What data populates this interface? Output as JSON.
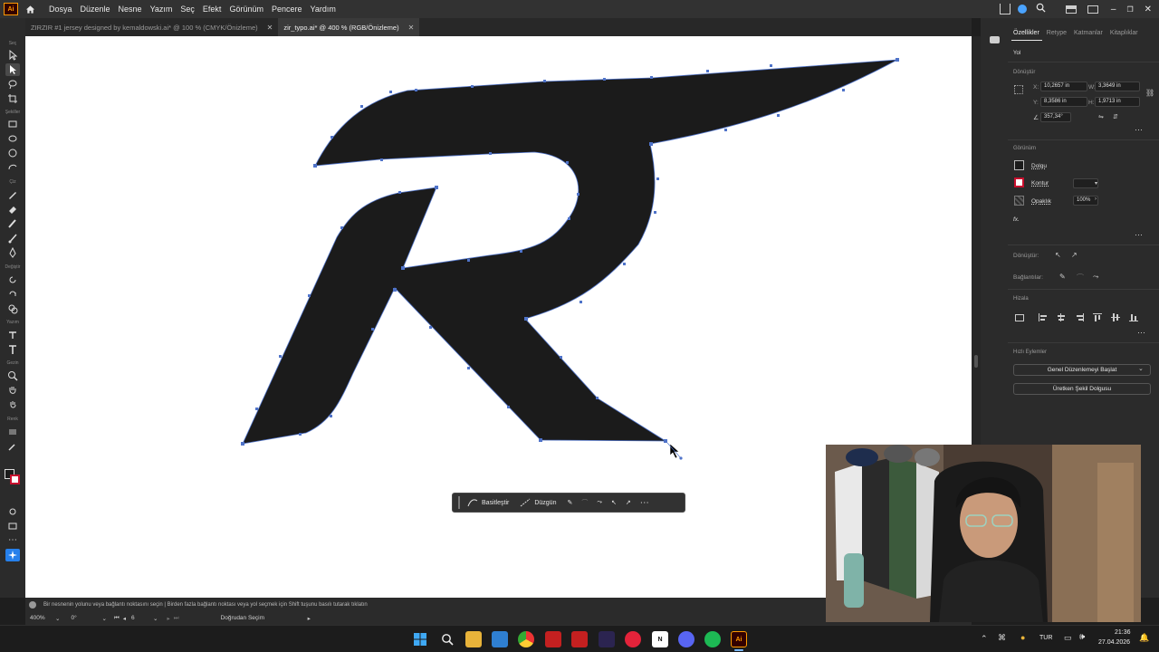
{
  "menu": {
    "items": [
      "Dosya",
      "Düzenle",
      "Nesne",
      "Yazım",
      "Seç",
      "Efekt",
      "Görünüm",
      "Pencere",
      "Yardım"
    ]
  },
  "tabs": [
    {
      "label": "ZIRZIR #1 jersey designed by kemaldowski.ai* @ 100 % (CMYK/Önizleme)",
      "active": false
    },
    {
      "label": "zir_typo.ai* @ 400 % (RGB/Önizleme)",
      "active": true
    }
  ],
  "toolbar": {
    "labels": {
      "sec": "Seç",
      "sekiller": "Şekiller",
      "ciz": "Çiz",
      "degistir": "Değiştir",
      "yazim": "Yazım",
      "gezin": "Gezin",
      "renk": "Renk"
    }
  },
  "properties": {
    "tabs": [
      "Özellikler",
      "Retype",
      "Katmanlar",
      "Kitaplıklar"
    ],
    "object_type": "Yol",
    "transform": {
      "title": "Dönüştür",
      "x": "10,2657 in",
      "y": "8,3586 in",
      "w": "3,3649 in",
      "h": "1,9713 in",
      "angle": "357,34°",
      "labels": {
        "x": "X:",
        "y": "Y:",
        "w": "W:",
        "h": "H:"
      }
    },
    "appearance": {
      "title": "Görünüm",
      "fill": "Dolgu",
      "stroke": "Kontur",
      "opacity_label": "Opaklık",
      "opacity": "100%",
      "fx": "fx."
    },
    "anchor_convert": "Dönüştür:",
    "handles": "Bağlantılar:",
    "align_title": "Hizala",
    "quick_actions": {
      "title": "Hızlı Eylemler",
      "general_edit": "Genel Düzenlemeyi Başlat",
      "generative_fill": "Üretken Şekil Dolgusu"
    }
  },
  "context_bar": {
    "simplify": "Basitleştir",
    "smooth": "Düzgün",
    "more": "⋯"
  },
  "status": {
    "hint": "Bir nesnenin yolunu veya bağlantı noktasını seçin  |  Birden fazla bağlantı noktası veya yol seçmek için Shift tuşunu basılı tutarak tıklatın",
    "zoom": "400%",
    "rotation": "0°",
    "artboard_num": "6",
    "tool_name": "Doğrudan Seçim"
  },
  "taskbar": {
    "language": "TUR",
    "time": "21:36",
    "date": "27.04.2026"
  },
  "colors": {
    "accent": "#2680eb",
    "path_fill": "#1b1b1b",
    "path_stroke": "#4f73c9",
    "stroke_swatch": "#c8102e"
  }
}
